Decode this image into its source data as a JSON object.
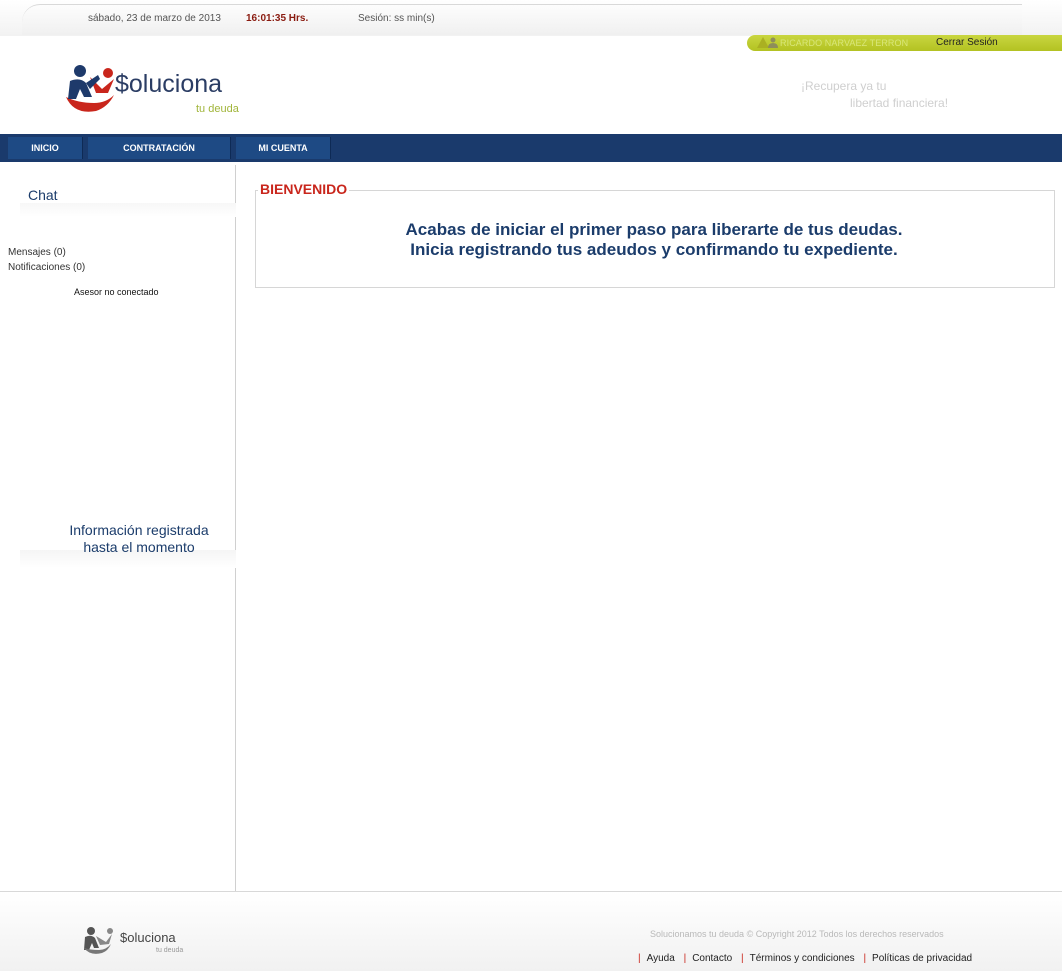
{
  "header": {
    "date": "sábado, 23 de marzo de 2013",
    "time": "16:01:35 Hrs.",
    "session": "Sesión: ss min(s)",
    "user_name": "RICARDO NARVAEZ TERRON",
    "logout_label": "Cerrar Sesión",
    "logo_text": "$oluciona",
    "logo_sub": "tu deuda",
    "slogan_line1": "¡Recupera ya tu",
    "slogan_line2": "libertad financiera!"
  },
  "nav": {
    "items": [
      {
        "label": "INICIO"
      },
      {
        "label": "CONTRATACIÓN"
      },
      {
        "label": "MI CUENTA"
      }
    ]
  },
  "sidebar": {
    "chat_title": "Chat",
    "messages": "Mensajes (0)",
    "notifications": "Notificaciones (0)",
    "advisor_status": "Asesor no conectado",
    "info_title_line1": "Información registrada",
    "info_title_line2": "hasta el momento"
  },
  "main": {
    "legend": "BIENVENIDO",
    "line1": "Acabas de iniciar el primer paso para liberarte de tus deudas.",
    "line2": "Inicia registrando tus adeudos y confirmando tu expediente."
  },
  "footer": {
    "logo_text": "$oluciona",
    "logo_sub": "tu deuda",
    "copyright": "Solucionamos tu deuda © Copyright 2012 Todos los derechos reservados",
    "links": [
      "Ayuda",
      "Contacto",
      "Términos y condiciones",
      "Políticas de privacidad"
    ],
    "separator": "|"
  },
  "colors": {
    "nav_bg": "#1a3a6c",
    "nav_button": "#1e4a84",
    "accent_red": "#c9261c",
    "user_bar": "#b3c222",
    "title_blue": "#1b3c6b"
  }
}
